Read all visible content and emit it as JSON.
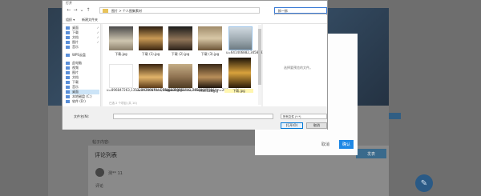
{
  "background": {
    "textarea_label": "帖子内容:",
    "comment_list_title": "评论列表",
    "post_button": "发表",
    "comment_user": "测** 11",
    "comment_text": "评论",
    "fab_icon": "edit-icon"
  },
  "upload_modal": {
    "hint": "添加说明或点击上传文件。",
    "cancel": "取消",
    "ok": "确认"
  },
  "dialog": {
    "title": "打开",
    "address": "图片 > 个人图集素材",
    "search_value": "拆一拆",
    "suggest_line1": "没有与搜索条件匹配的项。",
    "suggest_line2": "搜索范围：文件…",
    "toolbar": [
      "组织 ▾",
      "新建文件夹"
    ],
    "sidebar": [
      {
        "label": "桌面",
        "pinned": true
      },
      {
        "label": "下载",
        "pinned": true
      },
      {
        "label": "文档",
        "pinned": true
      },
      {
        "label": "图片",
        "pinned": true
      },
      {
        "label": "音乐",
        "pinned": false
      },
      {
        "label": "WPS云盘",
        "pinned": false
      },
      {
        "label": "此电脑",
        "pinned": false
      },
      {
        "label": "视频",
        "pinned": false
      },
      {
        "label": "图片",
        "pinned": false
      },
      {
        "label": "文档",
        "pinned": false
      },
      {
        "label": "下载",
        "pinned": false
      },
      {
        "label": "音乐",
        "pinned": false
      },
      {
        "label": "桌面",
        "pinned": false
      },
      {
        "label": "本地磁盘 (C:)",
        "pinned": false
      },
      {
        "label": "软件 (D:)",
        "pinned": false
      }
    ],
    "files": [
      {
        "name": "下载.jpg"
      },
      {
        "name": "下载 (1).jpg"
      },
      {
        "name": "下载 (2).jpg"
      },
      {
        "name": "下载 (3).jpg"
      },
      {
        "name": "u=641406882,3458983876&fm=26&gp=0.jpg"
      },
      {
        "name": "u=896847263,1353286286&fm=26&gp=0.jpg"
      },
      {
        "name": "u=3976097344,1946935075&fm=26&gp=0.jpg"
      },
      {
        "name": "u=2039562132,1456802731&fm=26&gp=0.jpg"
      },
      {
        "name": "11111.jpg"
      },
      {
        "name": "下载.jpg"
      }
    ],
    "preview_text": "选择要预览的文件。",
    "bottom_hint": "已选 2 个项目 (共 10)",
    "filename_label": "文件名(N):",
    "filetype": "所有文件 (*.*)",
    "open": "打开(O)",
    "cancel": "取消"
  }
}
